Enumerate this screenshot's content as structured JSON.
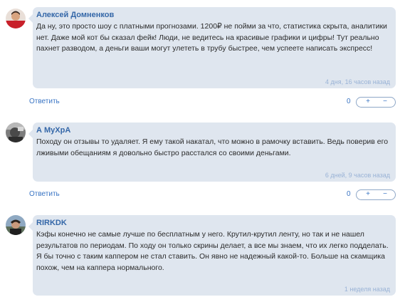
{
  "comments": [
    {
      "author": "Алексей Домненков",
      "avatar_icon": "user-photo-red",
      "text": "Да ну, это просто шоу с платными прогнозами. 1200₽ не пойми за что, статистика скрыта, аналитики нет. Даже мой кот бы сказал фейк! Люди, не ведитесь на красивые графики и цифры! Тут реально пахнет разводом, а деньги ваши могут улететь в трубу быстрее, чем успеете написать экспресс!",
      "time": "4 дня, 16 часов назад",
      "reply": "Ответить",
      "votes": "0",
      "plus": "+",
      "minus": "−"
    },
    {
      "author": "А МуХрА",
      "avatar_icon": "user-photo-dark",
      "text": "Походу он отзывы то удаляет. Я ему такой накатал, что можно в рамочку вставить. Ведь поверив его лживыми обещаниям я довольно быстро расстался со своими деньгами.",
      "time": "6 дней, 9 часов назад",
      "reply": "Ответить",
      "votes": "0",
      "plus": "+",
      "minus": "−"
    },
    {
      "author": "RIRKDK",
      "avatar_icon": "user-photo-outdoor",
      "text": "Кэфы конечно не самые лучше по бесплатным у него. Крутил-крутил ленту, но так и не нашел результатов по периодам. По ходу он только скрины делает, а все мы знаем, что их легко подделать. Я бы точно с таким каппером не стал ставить. Он явно не надежный какой-то. Больше на скамщика похож, чем на каппера нормального.",
      "time": "1 неделя назад"
    }
  ]
}
